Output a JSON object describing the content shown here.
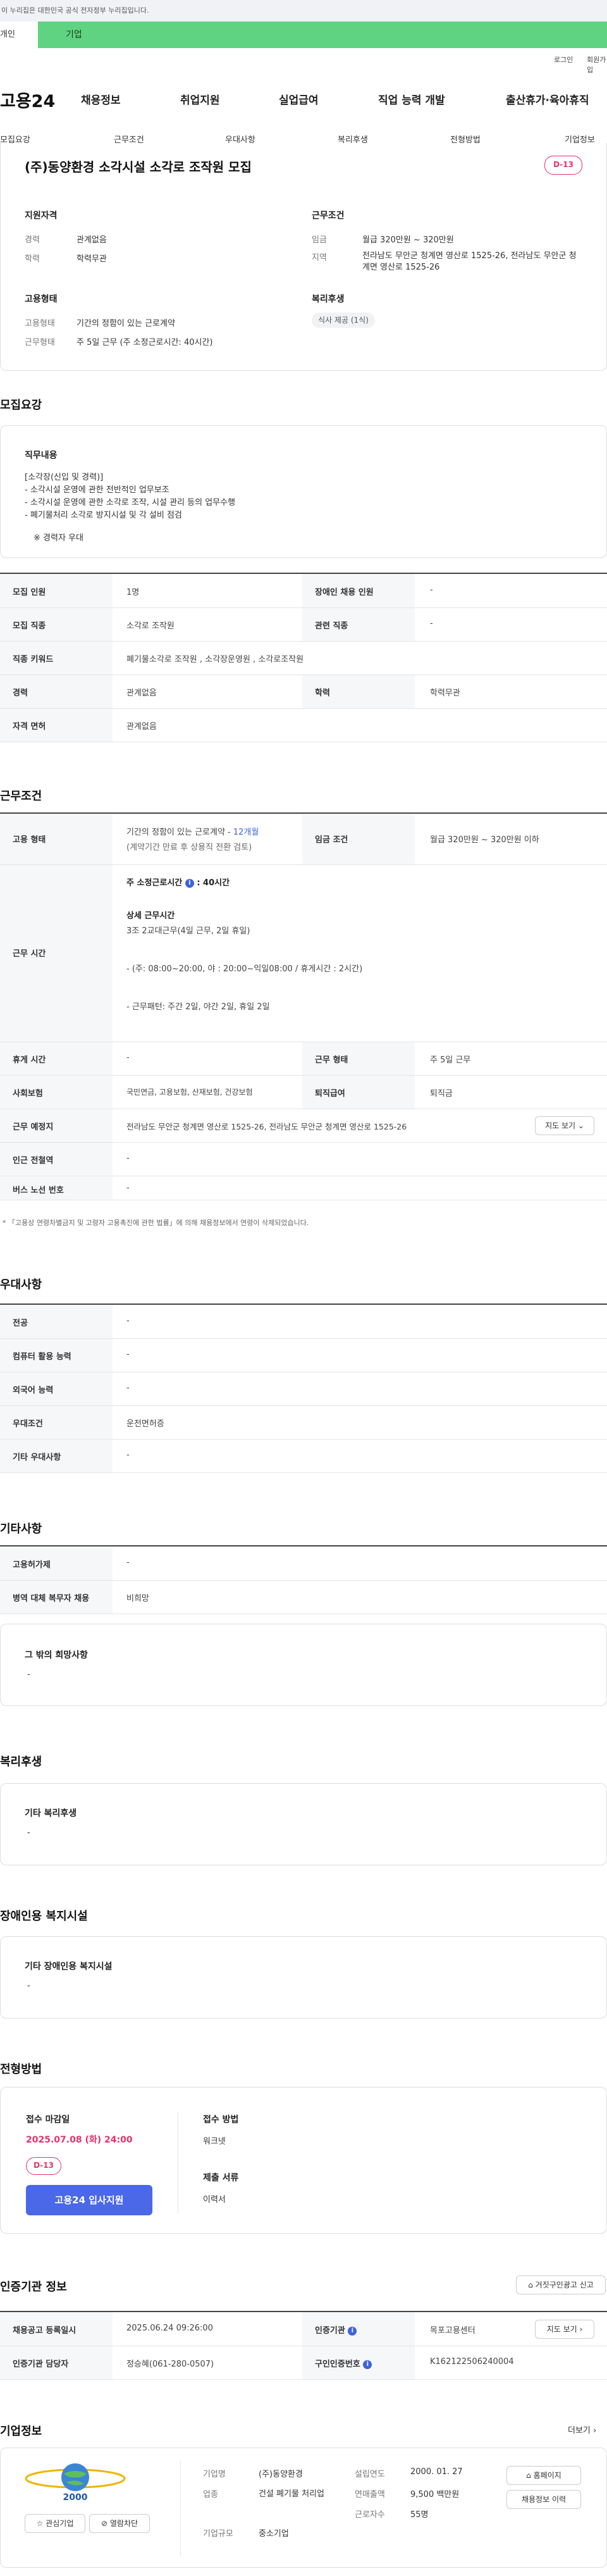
{
  "gov_bar": {
    "text": "이 누리집은 대한민국 공식 전자정부 누리집입니다."
  },
  "type_tabs": {
    "individual": "개인",
    "corporate": "기업"
  },
  "util": {
    "login": "로그인",
    "join": "회원가입"
  },
  "gnb": {
    "logo": "고용24",
    "items": [
      "채용정보",
      "취업지원",
      "실업급여",
      "직업 능력 개발",
      "출산휴가·육아휴직"
    ]
  },
  "anchors": [
    "모집요강",
    "근무조건",
    "우대사항",
    "복리후생",
    "전형방법",
    "기업정보"
  ],
  "summary": {
    "title": "(주)동양환경 소각시설 소각로 조작원 모집",
    "dday": "D-13",
    "qual_title": "지원자격",
    "career_label": "경력",
    "career_value": "관계없음",
    "edu_label": "학력",
    "edu_value": "학력무관",
    "cond_title": "근무조건",
    "wage_label": "임금",
    "wage_value": "월급 320만원 ~ 320만원",
    "region_label": "지역",
    "region_value": "전라남도 무안군 청계면 영산로 1525-26, 전라남도 무안군 청계면 영산로 1525-26",
    "emp_title": "고용형태",
    "emp_type_label": "고용형태",
    "emp_type_value": "기간의 정함이 있는 근로계약",
    "work_type_label": "근무형태",
    "work_type_value": "주 5일 근무 (주 소정근로시간: 40시간)",
    "welfare_title": "복리후생",
    "welfare_pill": "식사 제공 (1식)"
  },
  "recruit": {
    "section_title": "모집요강",
    "duty_title": "직무내용",
    "duty_lines": [
      "[소각장(신입 및 경력)]",
      "- 소각시설 운영에 관한 전반적인 업무보조",
      "- 소각시설 운영에 관한 소각로 조작, 시설 관리 등의 업무수행",
      "- 폐기물처리 소각로 방지시설 및 각 설비 점검"
    ],
    "duty_note": "※ 경력자 우대",
    "rows": [
      {
        "th1": "모집 인원",
        "td1": "1명",
        "th2": "장애인 채용 인원",
        "td2": "-"
      },
      {
        "th1": "모집 직종",
        "td1": "소각로 조작원",
        "th2": "관련 직종",
        "td2": "-"
      },
      {
        "th1": "직종 키워드",
        "td1": "폐기물소각로 조작원 , 소각장운영원 , 소각로조작원"
      },
      {
        "th1": "경력",
        "td1": "관계없음",
        "th2": "학력",
        "td2": "학력무관"
      },
      {
        "th1": "자격 면허",
        "td1": "관계없음"
      }
    ]
  },
  "work": {
    "section_title": "근무조건",
    "emp_th": "고용 형태",
    "emp_line1": "기간의 정함이 있는 근로계약 - ",
    "emp_line1_accent": "12개월",
    "emp_line2": "(계약기간 만료 후 상용직 전환 검토)",
    "wage_th": "임금 조건",
    "wage_td": "월급 320만원 ~ 320만원 이하",
    "hours_th": "근무 시간",
    "hours_head": "주 소정근로시간",
    "hours_head_val": ": 40시간",
    "hours_info": "i",
    "hours_detail_title": "상세 근무시간",
    "hours_detail_1": "3조 2교대근무(4일 근무, 2일 휴일)",
    "hours_detail_2": "- (주: 08:00~20:00, 야 : 20:00~익일08:00 / 휴게시간 : 2시간)",
    "hours_detail_3": "- 근무패턴: 주간 2일, 야간 2일, 휴일 2일",
    "rows": [
      {
        "th1": "휴게 시간",
        "td1": "-",
        "th2": "근무 형태",
        "td2": "주 5일 근무"
      },
      {
        "th1": "사회보험",
        "td1": "국민연금, 고용보험, 산재보험, 건강보험",
        "th2": "퇴직급여",
        "td2": "퇴직금"
      },
      {
        "th1": "근무 예정지",
        "td1": "전라남도 무안군 청계면 영산로 1525-26, 전라남도 무안군 청계면 영산로 1525-26",
        "btn": "지도 보기"
      },
      {
        "th1": "인근 전철역",
        "td1": "-"
      },
      {
        "th1": "버스 노선 번호",
        "td1": "-"
      }
    ],
    "note": "* 「고용상 연령차별금지 및 고령자 고용촉진에 관한 법률」에 의해 채용정보에서 연령이 삭제되었습니다."
  },
  "pref": {
    "section_title": "우대사항",
    "rows": [
      {
        "th": "전공",
        "td": "-"
      },
      {
        "th": "컴퓨터 활용 능력",
        "td": "-"
      },
      {
        "th": "외국어 능력",
        "td": "-"
      },
      {
        "th": "우대조건",
        "td": "운전면허증"
      },
      {
        "th": "기타 우대사항",
        "td": "-"
      }
    ]
  },
  "etc": {
    "section_title": "기타사항",
    "rows": [
      {
        "th": "고용허가제",
        "td": "-"
      },
      {
        "th": "병역 대체 복무자 채용",
        "td": "비희망"
      }
    ],
    "other_title": "그 밖의 희망사항",
    "other_value": "-"
  },
  "welfare": {
    "section_title": "복리후생",
    "card_title": "기타 복리후생",
    "card_value": "-"
  },
  "disability": {
    "section_title": "장애인용 복지시설",
    "card_title": "기타 장애인용 복지시설",
    "card_value": "-"
  },
  "screening": {
    "section_title": "전형방법",
    "deadline_title": "접수 마감일",
    "deadline_value": "2025.07.08 (화) 24:00",
    "dday": "D-13",
    "apply_button": "고용24 입사지원",
    "method_title": "접수 방법",
    "method_value": "워크넷",
    "docs_title": "제출 서류",
    "docs_value": "이력서"
  },
  "cert": {
    "section_title": "인증기관 정보",
    "report_button": "거짓구인광고 신고",
    "rows": [
      {
        "th1": "채용공고 등록일시",
        "td1": "2025.06.24 09:26:00",
        "th2": "인증기관",
        "td2": "목포고용센터",
        "btn": "지도 보기"
      },
      {
        "th1": "인증기관 담당자",
        "td1": "정승혜(061-280-0507)",
        "th2": "구인인증번호",
        "td2": "K162122506240004"
      }
    ]
  },
  "company": {
    "section_title": "기업정보",
    "more": "더보기",
    "logo_text": "2000",
    "interest_button": "관심기업",
    "block_button": "열람차단",
    "name_label": "기업명",
    "name_value": "(주)동양환경",
    "industry_label": "업종",
    "industry_value": "건설 폐기물 처리업",
    "size_label": "기업규모",
    "size_value": "중소기업",
    "founded_label": "설립연도",
    "founded_value": "2000. 01. 27",
    "sales_label": "연매출액",
    "sales_value": "9,500 백만원",
    "staff_label": "근로자수",
    "staff_value": "55명",
    "homepage_button": "홈페이지",
    "jobs_button": "채용정보 이력"
  },
  "colors": {
    "accent_green": "#5fd381",
    "dday_red": "#e5326b",
    "primary_blue": "#4b68e8",
    "info_blue": "#3d63dd"
  }
}
